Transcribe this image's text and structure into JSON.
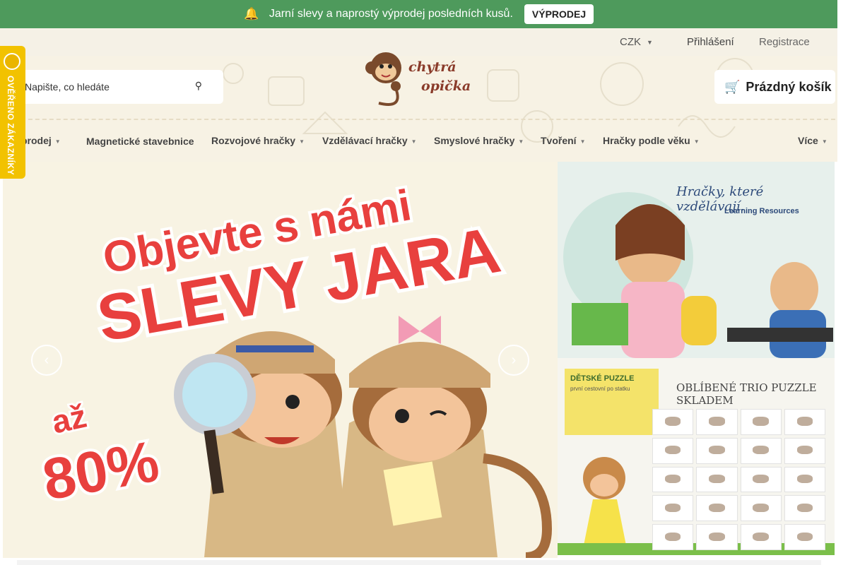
{
  "promo": {
    "icon": "bell-icon",
    "message": "Jarní slevy a naprostý výprodej posledních kusů.",
    "button": "VÝPRODEJ"
  },
  "userbar": {
    "currency": "CZK",
    "login": "Přihlášení",
    "register": "Registrace"
  },
  "header": {
    "search_placeholder": "Napište, co hledáte",
    "logo_line1": "chytrá",
    "logo_line2": "opička",
    "cart_label": "Prázdný košík"
  },
  "badge": {
    "text": "OVĚŘENO ZÁKAZNÍKY"
  },
  "nav": {
    "items": [
      {
        "label": "prodej"
      },
      {
        "label": "Magnetické stavebnice"
      },
      {
        "label": "Rozvojové hračky"
      },
      {
        "label": "Vzdělávací hračky"
      },
      {
        "label": "Smyslové hračky"
      },
      {
        "label": "Tvoření"
      },
      {
        "label": "Hračky podle věku"
      },
      {
        "label": "Více"
      }
    ]
  },
  "hero": {
    "line1": "Objevte s námi",
    "line2": "SLEVY JARA",
    "discount_prefix": "až",
    "discount_value": "80%"
  },
  "banner1": {
    "title": "Hračky, které vzdělávají.",
    "brand": "Learning Resources"
  },
  "banner2": {
    "box_title": "DĚTSKÉ PUZZLE",
    "box_subtitle": "první cestovní po statku",
    "title": "OBLÍBENÉ TRIO PUZZLE SKLADEM"
  },
  "colors": {
    "promo_bg": "#4e9a5c",
    "badge": "#f2c200",
    "hero_text": "#e8403e",
    "hero_bg": "#f8f3e3"
  }
}
